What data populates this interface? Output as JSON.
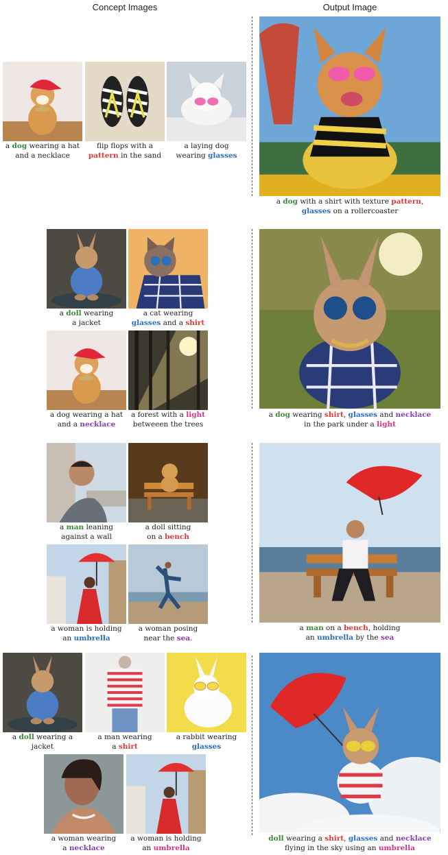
{
  "headers": {
    "concept": "Concept Images",
    "output": "Output Image"
  },
  "colors": {
    "green": "#3a8a3a",
    "red": "#e03a3a",
    "blue": "#2a6fc0",
    "purple": "#8a3fa6",
    "pink": "#d8338a"
  },
  "captions": {
    "r1a": [
      {
        "t": "a "
      },
      {
        "t": "dog",
        "c": "green"
      },
      {
        "t": " wearing a hat"
      },
      {
        "br": 1
      },
      {
        "t": "and a necklace"
      }
    ],
    "r1b": [
      {
        "t": "flip flops with a"
      },
      {
        "br": 1
      },
      {
        "t": "pattern",
        "c": "red"
      },
      {
        "t": " in the sand"
      }
    ],
    "r1c": [
      {
        "t": "a laying dog"
      },
      {
        "br": 1
      },
      {
        "t": "wearing "
      },
      {
        "t": "glasses",
        "c": "blue"
      }
    ],
    "r1o": [
      {
        "t": "a "
      },
      {
        "t": "dog",
        "c": "green"
      },
      {
        "t": " with a shirt with texture "
      },
      {
        "t": "pattern",
        "c": "red"
      },
      {
        "t": ","
      },
      {
        "br": 1
      },
      {
        "t": "glasses",
        "c": "blue"
      },
      {
        "t": " on a rollercoaster"
      }
    ],
    "r2a": [
      {
        "t": "a "
      },
      {
        "t": "doll",
        "c": "green"
      },
      {
        "t": " wearing"
      },
      {
        "br": 1
      },
      {
        "t": "a jacket"
      }
    ],
    "r2b": [
      {
        "t": "a cat wearing"
      },
      {
        "br": 1
      },
      {
        "t": "glasses",
        "c": "blue"
      },
      {
        "t": " and a "
      },
      {
        "t": "shirt",
        "c": "red"
      }
    ],
    "r2c": [
      {
        "t": "a dog wearing a hat"
      },
      {
        "br": 1
      },
      {
        "t": "and a "
      },
      {
        "t": "necklace",
        "c": "purple"
      }
    ],
    "r2d": [
      {
        "t": "a forest with a "
      },
      {
        "t": "light",
        "c": "pink"
      },
      {
        "br": 1
      },
      {
        "t": "betweeen the trees"
      }
    ],
    "r2o": [
      {
        "t": "a "
      },
      {
        "t": "dog",
        "c": "green"
      },
      {
        "t": " wearing "
      },
      {
        "t": "shirt",
        "c": "red"
      },
      {
        "t": ", "
      },
      {
        "t": "glasses",
        "c": "blue"
      },
      {
        "t": " and "
      },
      {
        "t": "necklace",
        "c": "purple"
      },
      {
        "br": 1
      },
      {
        "t": "in the park under a "
      },
      {
        "t": "light",
        "c": "pink"
      }
    ],
    "r3a": [
      {
        "t": "a "
      },
      {
        "t": "man",
        "c": "green"
      },
      {
        "t": " leaning"
      },
      {
        "br": 1
      },
      {
        "t": "against a wall"
      }
    ],
    "r3b": [
      {
        "t": "a doll sitting"
      },
      {
        "br": 1
      },
      {
        "t": "on a "
      },
      {
        "t": "bench",
        "c": "red"
      }
    ],
    "r3c": [
      {
        "t": "a woman is holding"
      },
      {
        "br": 1
      },
      {
        "t": "an "
      },
      {
        "t": "umbrella",
        "c": "blue"
      }
    ],
    "r3d": [
      {
        "t": "a woman posing"
      },
      {
        "br": 1
      },
      {
        "t": "near the "
      },
      {
        "t": "sea",
        "c": "purple"
      },
      {
        "t": "."
      }
    ],
    "r3o": [
      {
        "t": "a "
      },
      {
        "t": "man",
        "c": "green"
      },
      {
        "t": " on a "
      },
      {
        "t": "bench",
        "c": "red"
      },
      {
        "t": ", holding"
      },
      {
        "br": 1
      },
      {
        "t": "an "
      },
      {
        "t": "umbrella",
        "c": "blue"
      },
      {
        "t": " by the "
      },
      {
        "t": "sea",
        "c": "purple"
      }
    ],
    "r4a": [
      {
        "t": "a "
      },
      {
        "t": "doll",
        "c": "green"
      },
      {
        "t": " wearing a"
      },
      {
        "br": 1
      },
      {
        "t": "jacket"
      }
    ],
    "r4b": [
      {
        "t": "a man wearing"
      },
      {
        "br": 1
      },
      {
        "t": "a "
      },
      {
        "t": "shirt",
        "c": "red"
      }
    ],
    "r4c": [
      {
        "t": "a rabbit wearing"
      },
      {
        "br": 1
      },
      {
        "t": "glasses",
        "c": "blue"
      }
    ],
    "r4d": [
      {
        "t": "a woman wearing"
      },
      {
        "br": 1
      },
      {
        "t": "a "
      },
      {
        "t": "necklace",
        "c": "purple"
      }
    ],
    "r4e": [
      {
        "t": "a woman is holding"
      },
      {
        "br": 1
      },
      {
        "t": "an "
      },
      {
        "t": "umbrella",
        "c": "pink"
      }
    ],
    "r4o": [
      {
        "t": "doll",
        "c": "green"
      },
      {
        "t": " wearing a "
      },
      {
        "t": "shirt",
        "c": "red"
      },
      {
        "t": ", "
      },
      {
        "t": "glasses",
        "c": "blue"
      },
      {
        "t": " and "
      },
      {
        "t": "necklace",
        "c": "purple"
      },
      {
        "br": 1
      },
      {
        "t": "flying in the sky using an "
      },
      {
        "t": "umbrella",
        "c": "pink"
      }
    ]
  }
}
